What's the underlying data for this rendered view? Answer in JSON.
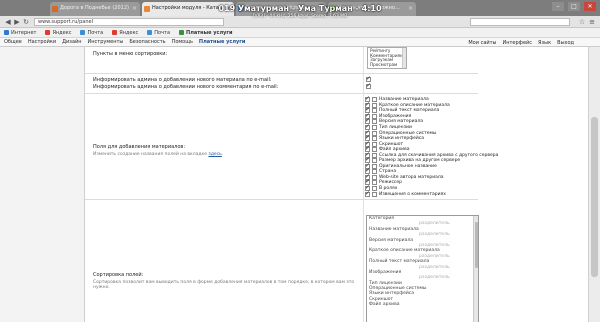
{
  "browser": {
    "tabs": [
      {
        "title": "Дорога в Поднебье (2012)",
        "active": false
      },
      {
        "title": "Настройки модуля - Ката...",
        "active": true
      },
      {
        "title": "Более двойное Нового...",
        "active": false
      },
      {
        "title": "Узнать что мы можно...",
        "active": false
      }
    ],
    "url": "www.support.ru/panel",
    "overlay_title": "019 Уматурман - Ума Турман - 4:10",
    "overlay_sub": "[VP3] - 44 kHz, 256 kbps, Stereo, 7.63 MB",
    "window_buttons": [
      "–",
      "□",
      "✕"
    ]
  },
  "bookmarks": [
    {
      "label": "Интернет",
      "color": "#2b7bd6"
    },
    {
      "label": "Яндекс",
      "color": "#e03a2f"
    },
    {
      "label": "Почта",
      "color": "#3a8fd9"
    },
    {
      "label": "Яндекс",
      "color": "#e03a2f"
    },
    {
      "label": "Почта",
      "color": "#3a8fd9"
    },
    {
      "label": "Платные услуги",
      "color": "#3c8f3c"
    }
  ],
  "admin_menu": {
    "items": [
      "Общее",
      "Настройки",
      "Дизайн",
      "Инструменты",
      "Безопасность",
      "Помощь"
    ],
    "paid_services": "Платные услуги",
    "right_items": [
      "Мои сайты",
      "Интерфейс",
      "Язык",
      "Выход"
    ]
  },
  "settings": {
    "menu_sort_label": "Пункты в меню сортировки:",
    "menu_sort_options": [
      "Рейтингу",
      "Комментариям",
      "Загрузкам",
      "Просмотрам"
    ],
    "notify_admin_material": "Информировать админа о добавлении нового материала по e-mail:",
    "notify_admin_comment": "Информировать админа о добавлении нового комментария по e-mail:",
    "fields_label": "Поля для добавления материалов:",
    "fields_hint_pre": "Изменить создание названия полей на вкладке ",
    "fields_hint_link": "здесь",
    "fields": [
      {
        "label": "Название материала",
        "c1": true,
        "c2": false
      },
      {
        "label": "Краткое описание материала",
        "c1": true,
        "c2": false
      },
      {
        "label": "Полный текст материала",
        "c1": true,
        "c2": false
      },
      {
        "label": "Изображения",
        "c1": true,
        "c2": false
      },
      {
        "label": "Версия материала",
        "c1": true,
        "c2": false
      },
      {
        "label": "Тип лицензии",
        "c1": true,
        "c2": false
      },
      {
        "label": "Операционные системы",
        "c1": true,
        "c2": false
      },
      {
        "label": "Языки интерфейса",
        "c1": true,
        "c2": false
      },
      {
        "label": "Скриншот",
        "c1": true,
        "c2": false
      },
      {
        "label": "Файл архива",
        "c1": true,
        "c2": false
      },
      {
        "label": "Ссылка для скачивания архива с другого сервера",
        "c1": true,
        "c2": false
      },
      {
        "label": "Размер архива на другом сервере",
        "c1": true,
        "c2": false
      },
      {
        "label": "Оригинальное название",
        "c1": true,
        "c2": false
      },
      {
        "label": "Страна",
        "c1": true,
        "c2": false
      },
      {
        "label": "Web-site автора материала",
        "c1": true,
        "c2": false
      },
      {
        "label": "Режиссер",
        "c1": true,
        "c2": false
      },
      {
        "label": "В ролях",
        "c1": true,
        "c2": false
      },
      {
        "label": "Извещения о комментариях",
        "c1": true,
        "c2": false
      }
    ],
    "sort_fields_label": "Сортировка полей:",
    "sort_fields_hint": "Сортировка позволит вам выводить поля в форме добавления материалов в том порядке, в котором вам это нужно.",
    "sort_divider": "разделитель",
    "sort_options": [
      "Категория",
      "Название материала",
      "Версия материала",
      "Краткое описание материала",
      "Полный текст материала",
      "Изображения",
      "Тип лицензии",
      "Операционные системы",
      "Языки интерфейса",
      "Скриншот",
      "Файл архива"
    ]
  }
}
